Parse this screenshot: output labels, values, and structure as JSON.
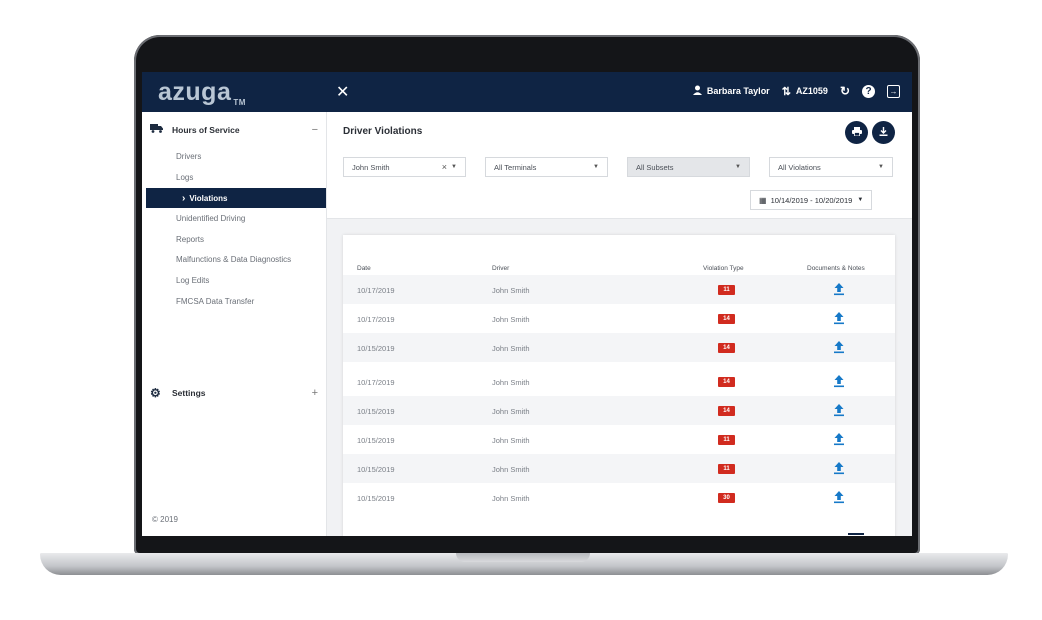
{
  "topbar": {
    "logo": "azuga",
    "logo_tm": "TM",
    "close_label": "✕",
    "user_name": "Barbara Taylor",
    "vehicle_id": "AZ1059"
  },
  "sidebar": {
    "section_hos": "Hours of Service",
    "section_hos_toggle": "−",
    "items": [
      "Drivers",
      "Logs",
      "Violations",
      "Unidentified Driving",
      "Reports",
      "Malfunctions & Data Diagnostics",
      "Log Edits",
      "FMCSA Data Transfer"
    ],
    "active_marker": "›",
    "section_settings": "Settings",
    "section_settings_toggle": "+",
    "copyright": "© 2019"
  },
  "main": {
    "title": "Driver Violations",
    "filters": {
      "driver": "John Smith",
      "driver_clear": "×",
      "terminals": "All Terminals",
      "subsets": "All Subsets",
      "violations": "All Violations"
    },
    "date_range": "10/14/2019 - 10/20/2019",
    "table": {
      "headers": [
        "Date",
        "Driver",
        "Violation Type",
        "Documents & Notes"
      ],
      "rows": [
        {
          "date": "10/17/2019",
          "driver": "John Smith",
          "violation": "11"
        },
        {
          "date": "10/17/2019",
          "driver": "John Smith",
          "violation": "14"
        },
        {
          "date": "10/15/2019",
          "driver": "John Smith",
          "violation": "14"
        },
        {
          "date": "10/17/2019",
          "driver": "John Smith",
          "violation": "14"
        },
        {
          "date": "10/15/2019",
          "driver": "John Smith",
          "violation": "14"
        },
        {
          "date": "10/15/2019",
          "driver": "John Smith",
          "violation": "11"
        },
        {
          "date": "10/15/2019",
          "driver": "John Smith",
          "violation": "11"
        },
        {
          "date": "10/15/2019",
          "driver": "John Smith",
          "violation": "30"
        }
      ]
    }
  },
  "colors": {
    "navy": "#0f2444",
    "violation_red": "#d12b1f",
    "upload_blue": "#1679c8"
  },
  "icons": [
    "truck-icon",
    "user-icon",
    "switch-icon",
    "refresh-icon",
    "help-icon",
    "logout-icon",
    "gear-icon",
    "print-icon",
    "download-icon",
    "calendar-icon",
    "upload-icon"
  ]
}
